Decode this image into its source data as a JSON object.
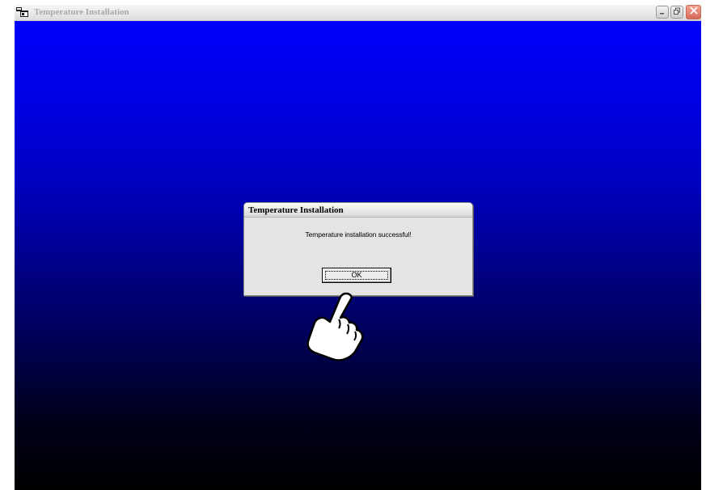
{
  "window": {
    "title": "Temperature Installation",
    "app_icon": "app-icon",
    "controls": [
      "minimize-icon",
      "maximize-icon",
      "close-icon"
    ]
  },
  "dialog": {
    "title": "Temperature Installation",
    "message": "Temperature installation successful!",
    "ok_label": "OK"
  },
  "cursor": {
    "icon": "hand-pointer-icon"
  },
  "colors": {
    "background_top": "#0000fb",
    "background_bottom": "#000000",
    "dialog_bg": "#e4e4e4",
    "title_text_inactive": "#a8a8a8",
    "close_button": "#d9695a"
  }
}
